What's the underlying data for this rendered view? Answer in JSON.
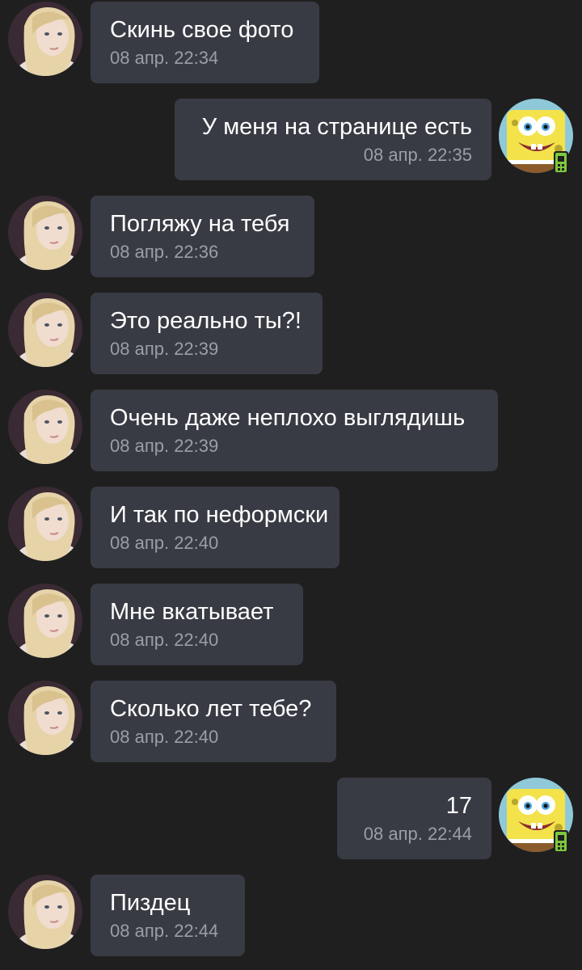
{
  "messages": [
    {
      "side": "left",
      "text": "Скинь свое фото",
      "time": "08 апр. 22:34"
    },
    {
      "side": "right",
      "text": "У меня на странице есть",
      "time": "08 апр. 22:35"
    },
    {
      "side": "left",
      "text": "Погляжу на тебя",
      "time": "08 апр. 22:36"
    },
    {
      "side": "left",
      "text": "Это реально ты?!",
      "time": "08 апр. 22:39"
    },
    {
      "side": "left",
      "text": "Очень даже неплохо выглядишь",
      "time": "08 апр. 22:39"
    },
    {
      "side": "left",
      "text": "И так по неформски",
      "time": "08 апр. 22:40"
    },
    {
      "side": "left",
      "text": "Мне вкатывает",
      "time": "08 апр. 22:40"
    },
    {
      "side": "left",
      "text": "Сколько лет тебе?",
      "time": "08 апр. 22:40"
    },
    {
      "side": "right",
      "text": "17",
      "time": "08 апр. 22:44"
    },
    {
      "side": "left",
      "text": "Пиздец",
      "time": "08 апр. 22:44"
    }
  ],
  "avatars": {
    "left": "user-avatar-girl-photo",
    "right": "user-avatar-spongebob"
  },
  "icons": {
    "mobile_badge": "mobile-phone-icon"
  },
  "colors": {
    "background": "#1f1f1f",
    "bubble": "#393b44",
    "text": "#ffffff",
    "time": "#9c9ea7",
    "mobile_badge": "#7ec93b"
  }
}
